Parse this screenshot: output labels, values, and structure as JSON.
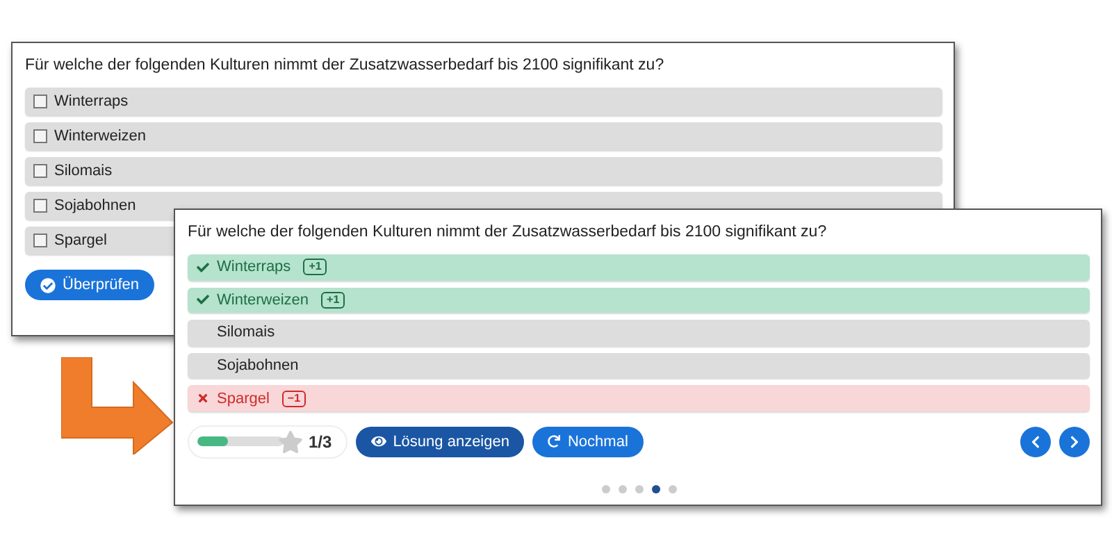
{
  "before": {
    "question": "Für welche der folgenden Kulturen nimmt der Zusatzwasserbedarf bis 2100 signifikant zu?",
    "options": [
      {
        "label": "Winterraps",
        "checked": false
      },
      {
        "label": "Winterweizen",
        "checked": false
      },
      {
        "label": "Silomais",
        "checked": false
      },
      {
        "label": "Sojabohnen",
        "checked": false
      },
      {
        "label": "Spargel",
        "checked": false
      }
    ],
    "check_button": "Überprüfen"
  },
  "after": {
    "question": "Für welche der folgenden Kulturen nimmt der Zusatzwasserbedarf bis 2100 signifikant zu?",
    "options": [
      {
        "label": "Winterraps",
        "kind": "correct",
        "badge": "+1"
      },
      {
        "label": "Winterweizen",
        "kind": "correct",
        "badge": "+1"
      },
      {
        "label": "Silomais",
        "kind": "neutral"
      },
      {
        "label": "Sojabohnen",
        "kind": "neutral"
      },
      {
        "label": "Spargel",
        "kind": "wrong",
        "badge": "−1"
      }
    ],
    "score": {
      "level": 0.35,
      "text": "1/3"
    },
    "buttons": [
      {
        "label": "Lösung anzeigen",
        "kind": "solution"
      },
      {
        "label": "Nochmal",
        "kind": "retry"
      }
    ],
    "pages": [
      {
        "selected": false
      },
      {
        "selected": false
      },
      {
        "selected": false
      },
      {
        "selected": true
      },
      {
        "selected": false
      }
    ]
  }
}
